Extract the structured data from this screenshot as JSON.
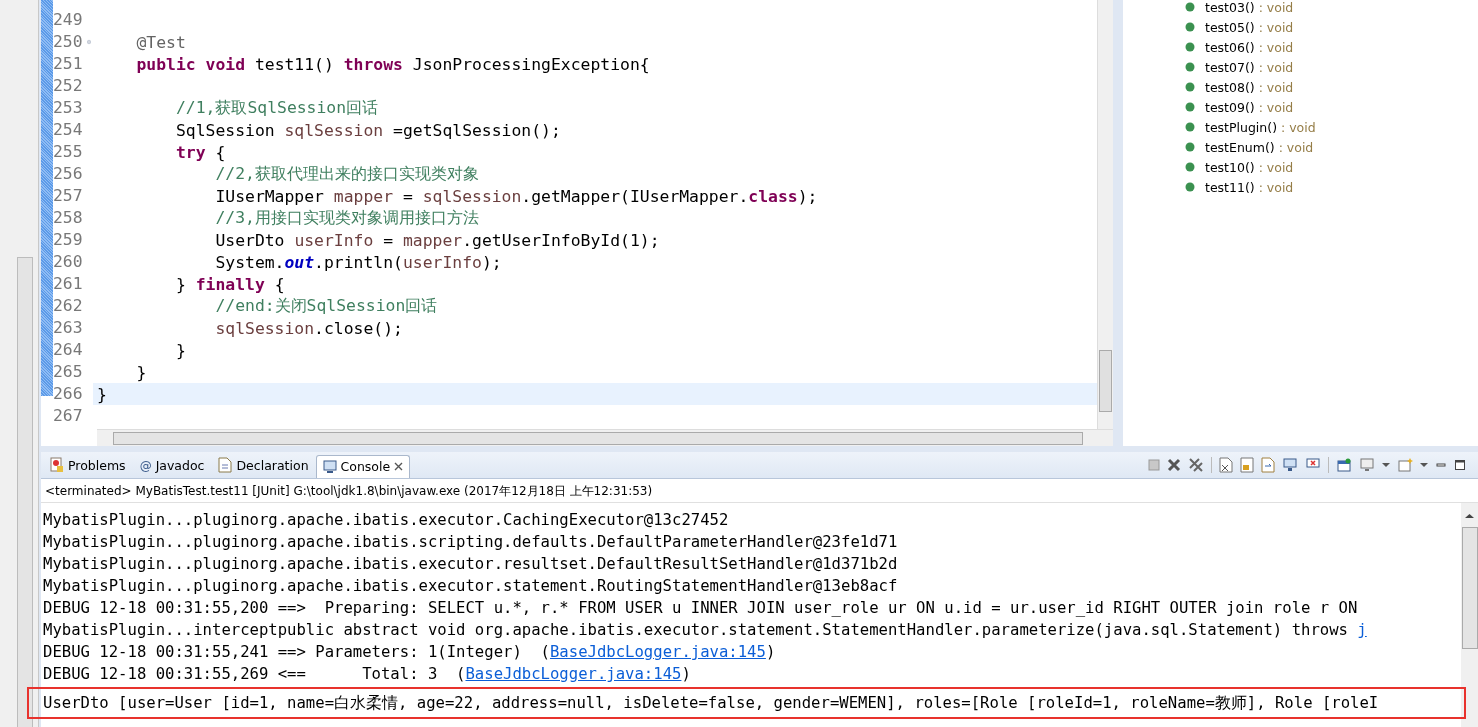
{
  "editor": {
    "lines": [
      {
        "number": "249",
        "current": false,
        "fold": false
      },
      {
        "number": "250",
        "tokens": [
          {
            "kind": "annotation",
            "text": "    @Test"
          }
        ],
        "current": false,
        "fold": true
      },
      {
        "number": "251",
        "tokens": [
          {
            "kind": "keyword",
            "text": "    public"
          },
          {
            "kind": "keyword",
            "text": " void"
          },
          {
            "kind": "plain",
            "text": " test11() "
          },
          {
            "kind": "keyword",
            "text": "throws"
          },
          {
            "kind": "plain",
            "text": " JsonProcessingException{"
          }
        ],
        "current": false,
        "fold": false
      },
      {
        "number": "252",
        "current": false,
        "fold": false
      },
      {
        "number": "253",
        "tokens": [
          {
            "kind": "comment",
            "text": "        //1,获取SqlSession回话"
          }
        ],
        "current": false,
        "fold": false
      },
      {
        "number": "254",
        "tokens": [
          {
            "kind": "plain",
            "text": "        SqlSession "
          },
          {
            "kind": "variable",
            "text": "sqlSession"
          },
          {
            "kind": "plain",
            "text": " =getSqlSession();"
          }
        ],
        "current": false,
        "fold": false
      },
      {
        "number": "255",
        "tokens": [
          {
            "kind": "keyword",
            "text": "        try"
          },
          {
            "kind": "plain",
            "text": " {"
          }
        ],
        "current": false,
        "fold": false
      },
      {
        "number": "256",
        "tokens": [
          {
            "kind": "comment",
            "text": "            //2,获取代理出来的接口实现类对象"
          }
        ],
        "current": false,
        "fold": false
      },
      {
        "number": "257",
        "tokens": [
          {
            "kind": "plain",
            "text": "            IUserMapper "
          },
          {
            "kind": "variable",
            "text": "mapper"
          },
          {
            "kind": "plain",
            "text": " = "
          },
          {
            "kind": "variable",
            "text": "sqlSession"
          },
          {
            "kind": "plain",
            "text": ".getMapper(IUserMapper."
          },
          {
            "kind": "keyword",
            "text": "class"
          },
          {
            "kind": "plain",
            "text": ");"
          }
        ],
        "current": false,
        "fold": false
      },
      {
        "number": "258",
        "tokens": [
          {
            "kind": "comment",
            "text": "            //3,用接口实现类对象调用接口方法"
          }
        ],
        "current": false,
        "fold": false
      },
      {
        "number": "259",
        "tokens": [
          {
            "kind": "plain",
            "text": "            UserDto "
          },
          {
            "kind": "variable",
            "text": "userInfo"
          },
          {
            "kind": "plain",
            "text": " = "
          },
          {
            "kind": "variable",
            "text": "mapper"
          },
          {
            "kind": "plain",
            "text": ".getUserInfoById(1);"
          }
        ],
        "current": false,
        "fold": false
      },
      {
        "number": "260",
        "tokens": [
          {
            "kind": "plain",
            "text": "            System."
          },
          {
            "kind": "static",
            "text": "out"
          },
          {
            "kind": "plain",
            "text": ".println("
          },
          {
            "kind": "variable",
            "text": "userInfo"
          },
          {
            "kind": "plain",
            "text": ");"
          }
        ],
        "current": false,
        "fold": false
      },
      {
        "number": "261",
        "tokens": [
          {
            "kind": "plain",
            "text": "        } "
          },
          {
            "kind": "keyword",
            "text": "finally"
          },
          {
            "kind": "plain",
            "text": " {"
          }
        ],
        "current": false,
        "fold": false
      },
      {
        "number": "262",
        "tokens": [
          {
            "kind": "comment",
            "text": "            //end:关闭SqlSession回话"
          }
        ],
        "current": false,
        "fold": false
      },
      {
        "number": "263",
        "tokens": [
          {
            "kind": "variable",
            "text": "            sqlSession"
          },
          {
            "kind": "plain",
            "text": ".close();"
          }
        ],
        "current": false,
        "fold": false
      },
      {
        "number": "264",
        "tokens": [
          {
            "kind": "plain",
            "text": "        }"
          }
        ],
        "current": false,
        "fold": false
      },
      {
        "number": "265",
        "tokens": [
          {
            "kind": "plain",
            "text": "    }"
          }
        ],
        "current": false,
        "fold": false
      },
      {
        "number": "266",
        "tokens": [
          {
            "kind": "plain",
            "text": "}"
          }
        ],
        "current": true,
        "fold": false
      },
      {
        "number": "267",
        "current": false,
        "fold": false
      }
    ]
  },
  "outline": {
    "items": [
      {
        "name": "test03()",
        "type": " : void"
      },
      {
        "name": "test05()",
        "type": " : void"
      },
      {
        "name": "test06()",
        "type": " : void"
      },
      {
        "name": "test07()",
        "type": " : void"
      },
      {
        "name": "test08()",
        "type": " : void"
      },
      {
        "name": "test09()",
        "type": " : void"
      },
      {
        "name": "testPlugin()",
        "type": " : void"
      },
      {
        "name": "testEnum()",
        "type": " : void"
      },
      {
        "name": "test10()",
        "type": " : void"
      },
      {
        "name": "test11()",
        "type": " : void"
      }
    ]
  },
  "console": {
    "tabs": [
      {
        "kind": "problems",
        "label": "Problems",
        "selected": false
      },
      {
        "kind": "javadoc",
        "glyph": "@",
        "label": "Javadoc",
        "selected": false
      },
      {
        "kind": "declaration",
        "label": "Declaration",
        "selected": false
      },
      {
        "kind": "console",
        "label": "Console",
        "selected": true
      }
    ],
    "status": "<terminated> MyBatisTest.test11 [JUnit] G:\\tool\\jdk1.8\\bin\\javaw.exe (2017年12月18日 上午12:31:53)",
    "lines": [
      {
        "parts": [
          {
            "kind": "text",
            "text": "MybatisPlugin...pluginorg.apache.ibatis.executor.CachingExecutor@13c27452"
          }
        ]
      },
      {
        "parts": [
          {
            "kind": "text",
            "text": "MybatisPlugin...pluginorg.apache.ibatis.scripting.defaults.DefaultParameterHandler@23fe1d71"
          }
        ]
      },
      {
        "parts": [
          {
            "kind": "text",
            "text": "MybatisPlugin...pluginorg.apache.ibatis.executor.resultset.DefaultResultSetHandler@1d371b2d"
          }
        ]
      },
      {
        "parts": [
          {
            "kind": "text",
            "text": "MybatisPlugin...pluginorg.apache.ibatis.executor.statement.RoutingStatementHandler@13eb8acf"
          }
        ]
      },
      {
        "parts": [
          {
            "kind": "text",
            "text": "DEBUG 12-18 00:31:55,200 ==>  Preparing: SELECT u.*, r.* FROM USER u INNER JOIN user_role ur ON u.id = ur.user_id RIGHT OUTER join role r ON"
          }
        ]
      },
      {
        "parts": [
          {
            "kind": "text",
            "text": "MybatisPlugin...interceptpublic abstract void org.apache.ibatis.executor.statement.StatementHandler.parameterize(java.sql.Statement) throws "
          },
          {
            "kind": "link",
            "text": "j"
          }
        ]
      },
      {
        "parts": [
          {
            "kind": "text",
            "text": "DEBUG 12-18 00:31:55,241 ==> Parameters: 1(Integer)  ("
          },
          {
            "kind": "link",
            "text": "BaseJdbcLogger.java:145"
          },
          {
            "kind": "text",
            "text": ")"
          }
        ]
      },
      {
        "parts": [
          {
            "kind": "text",
            "text": "DEBUG 12-18 00:31:55,269 <==      Total: 3  ("
          },
          {
            "kind": "link",
            "text": "BaseJdbcLogger.java:145"
          },
          {
            "kind": "text",
            "text": ")"
          }
        ]
      },
      {
        "highlighted": true,
        "parts": [
          {
            "kind": "text",
            "text": "UserDto [user=User [id=1, name=白水柔情, age=22, address=null, isDelete=false, gender=WEMEN], roles=[Role [roleId=1, roleName=教师], Role [roleI"
          }
        ]
      }
    ]
  }
}
